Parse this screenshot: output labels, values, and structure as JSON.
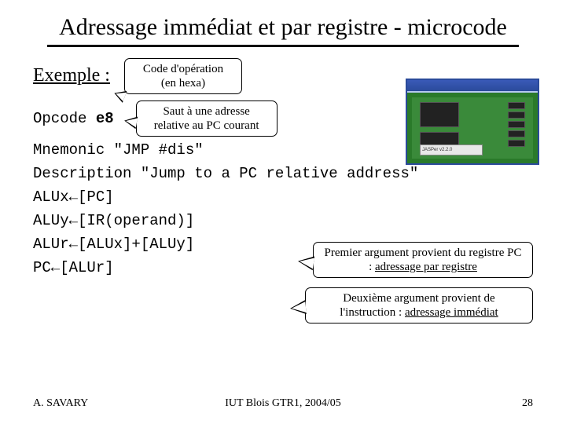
{
  "title": "Adressage immédiat et par registre - microcode",
  "exemple_label": "Exemple :",
  "callout1_line1": "Code d'opération",
  "callout1_line2": "(en hexa)",
  "callout2_line1": "Saut à une adresse",
  "callout2_line2": "relative au PC courant",
  "opcode_label": "Opcode ",
  "opcode_value": "e8",
  "mnemonic_line": "Mnemonic \"JMP #dis\"",
  "description_line": "Description \"Jump to a PC relative address\"",
  "micro1": "ALUx←[PC]",
  "micro2": "ALUy←[IR(operand)]",
  "micro3": "ALUr←[ALUx]+[ALUy]",
  "micro4": "PC←[ALUr]",
  "callout3_pre": "Premier argument provient du registre PC : ",
  "callout3_u": "adressage par registre",
  "callout4_pre": "Deuxième argument provient de l'instruction : ",
  "callout4_u": "adressage immédiat",
  "sim_panel": "JASPer v2.2.0",
  "footer_left": "A. SAVARY",
  "footer_center": "IUT Blois GTR1, 2004/05",
  "footer_right": "28"
}
